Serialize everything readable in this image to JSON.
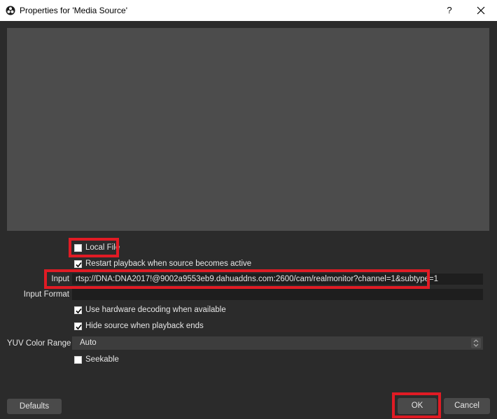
{
  "window": {
    "title": "Properties for 'Media Source'",
    "help_label": "?",
    "icon": "obs-logo-icon"
  },
  "form": {
    "local_file": {
      "label": "Local File",
      "checked": false
    },
    "restart_playback": {
      "label": "Restart playback when source becomes active",
      "checked": true
    },
    "input": {
      "label": "Input",
      "value": "rtsp://DNA:DNA2017!@9002a9553eb9.dahuaddns.com:2600/cam/realmonitor?channel=1&subtype=1"
    },
    "input_format": {
      "label": "Input Format",
      "value": ""
    },
    "hw_decoding": {
      "label": "Use hardware decoding when available",
      "checked": true
    },
    "hide_source": {
      "label": "Hide source when playback ends",
      "checked": true
    },
    "yuv_color_range": {
      "label": "YUV Color Range",
      "value": "Auto"
    },
    "seekable": {
      "label": "Seekable",
      "checked": false
    }
  },
  "buttons": {
    "defaults": "Defaults",
    "ok": "OK",
    "cancel": "Cancel"
  },
  "colors": {
    "background": "#2b2b2b",
    "preview": "#4c4c4c",
    "highlight": "#e01b24"
  }
}
